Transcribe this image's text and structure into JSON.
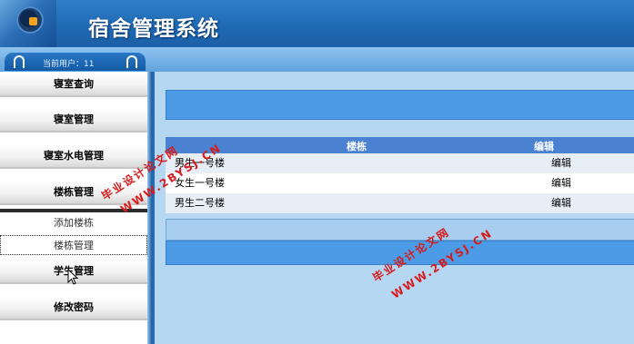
{
  "header": {
    "title": "宿舍管理系统"
  },
  "user": {
    "label": "当前用户：11"
  },
  "menu": {
    "items": [
      {
        "label": "寝室查询"
      },
      {
        "label": "寝室管理"
      },
      {
        "label": "寝室水电管理"
      },
      {
        "label": "楼栋管理"
      },
      {
        "label": "学生管理"
      },
      {
        "label": "修改密码"
      }
    ],
    "subitems": [
      {
        "label": "添加楼栋"
      },
      {
        "label": "楼栋管理"
      }
    ]
  },
  "table": {
    "headers": [
      "楼栋",
      "编辑"
    ],
    "rows": [
      {
        "name": "男生一号楼",
        "action": "编辑"
      },
      {
        "name": "女生一号楼",
        "action": "编辑"
      },
      {
        "name": "男生二号楼",
        "action": "编辑"
      }
    ]
  },
  "watermark": {
    "line1": "毕业设计论文网",
    "line2": "WWW.2BYSJ.CN"
  },
  "colors": {
    "accent": "#4b9be6",
    "header": "#1f68b2",
    "watermark": "#d81b1b"
  }
}
